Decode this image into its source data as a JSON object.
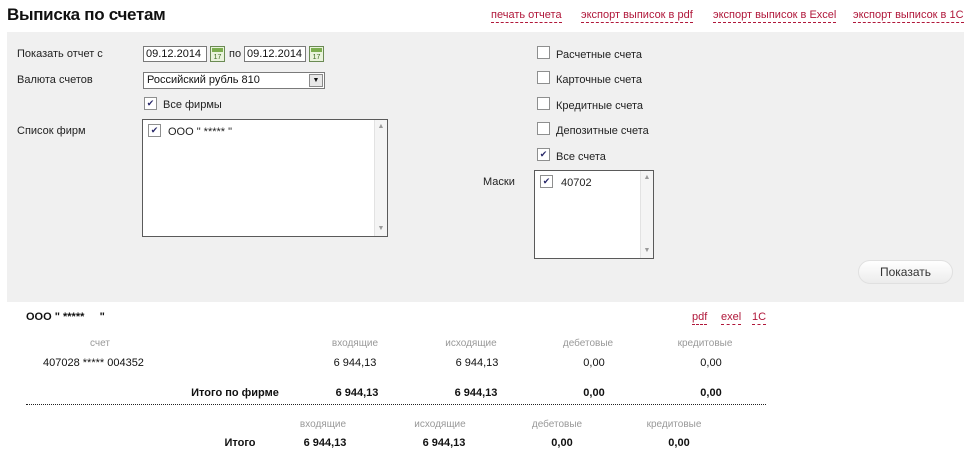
{
  "header": {
    "title": "Выписка по счетам",
    "links": {
      "print": "печать отчета",
      "pdf": "экспорт выписок в pdf",
      "excel": "экспорт выписок в Excel",
      "c1": "экспорт выписок в 1С"
    }
  },
  "filter": {
    "period_label": "Показать отчет с",
    "date_from": "09.12.2014",
    "to_label": "по",
    "date_to": "09.12.2014",
    "calendar_icon_text": "17",
    "currency_label": "Валюта счетов",
    "currency_value": "Российский рубль 810",
    "all_firms_label": "Все фирмы",
    "all_firms_checked": true,
    "firms_label": "Список фирм",
    "firms": [
      {
        "name": "ООО \" ***** \"",
        "checked": true
      }
    ],
    "account_types": [
      {
        "label": "Расчетные счета",
        "checked": false
      },
      {
        "label": "Карточные счета",
        "checked": false
      },
      {
        "label": "Кредитные счета",
        "checked": false
      },
      {
        "label": "Депозитные счета",
        "checked": false
      },
      {
        "label": "Все счета",
        "checked": true
      }
    ],
    "masks_label": "Маски",
    "masks": [
      {
        "value": "40702",
        "checked": true
      }
    ],
    "show_button": "Показать"
  },
  "report": {
    "firm_name": "ООО \" *****     \"",
    "links": {
      "pdf": "pdf",
      "excel": "exel",
      "c1": "1С"
    },
    "columns": {
      "account": "счет",
      "incoming": "входящие",
      "outgoing": "исходящие",
      "debit": "дебетовые",
      "credit": "кредитовые"
    },
    "rows": [
      {
        "account": "407028 ***** 004352",
        "incoming": "6 944,13",
        "outgoing": "6 944,13",
        "debit": "0,00",
        "credit": "0,00"
      }
    ],
    "firm_total": {
      "label": "Итого по фирме",
      "incoming": "6 944,13",
      "outgoing": "6 944,13",
      "debit": "0,00",
      "credit": "0,00"
    },
    "grand_total": {
      "label": "Итого",
      "columns": {
        "incoming": "входящие",
        "outgoing": "исходящие",
        "debit": "дебетовые",
        "credit": "кредитовые"
      },
      "incoming": "6 944,13",
      "outgoing": "6 944,13",
      "debit": "0,00",
      "credit": "0,00"
    }
  },
  "colors": {
    "link": "#b0173a",
    "panel_bg": "#f0f0f0",
    "column_header": "#999999"
  }
}
